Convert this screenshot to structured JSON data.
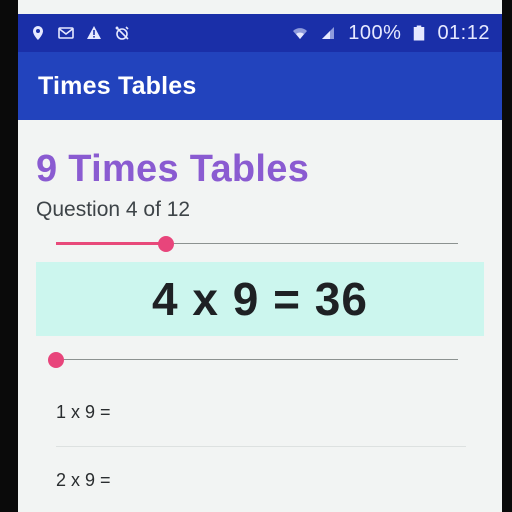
{
  "statusbar": {
    "battery": "100%",
    "time": "01:12",
    "left_icons": [
      "location-icon",
      "mail-icon",
      "warning-icon",
      "alarm-off-icon"
    ],
    "right_icons": [
      "wifi-icon",
      "signal-icon",
      "battery-icon"
    ]
  },
  "appbar": {
    "title": "Times Tables"
  },
  "page": {
    "title": "9 Times Tables",
    "question_label": "Question 4 of 12"
  },
  "progress": {
    "value": 4,
    "max": 12
  },
  "answer": {
    "text": "4 x 9 = 36"
  },
  "answer_slider": {
    "value": 0
  },
  "questions": [
    {
      "label": "1 x 9 ="
    },
    {
      "label": "2 x 9 ="
    }
  ],
  "colors": {
    "statusbar": "#1a2fa8",
    "appbar": "#2243bd",
    "title": "#8a5bd1",
    "accent": "#e8457b",
    "answer_bg": "#ccf6ee"
  }
}
